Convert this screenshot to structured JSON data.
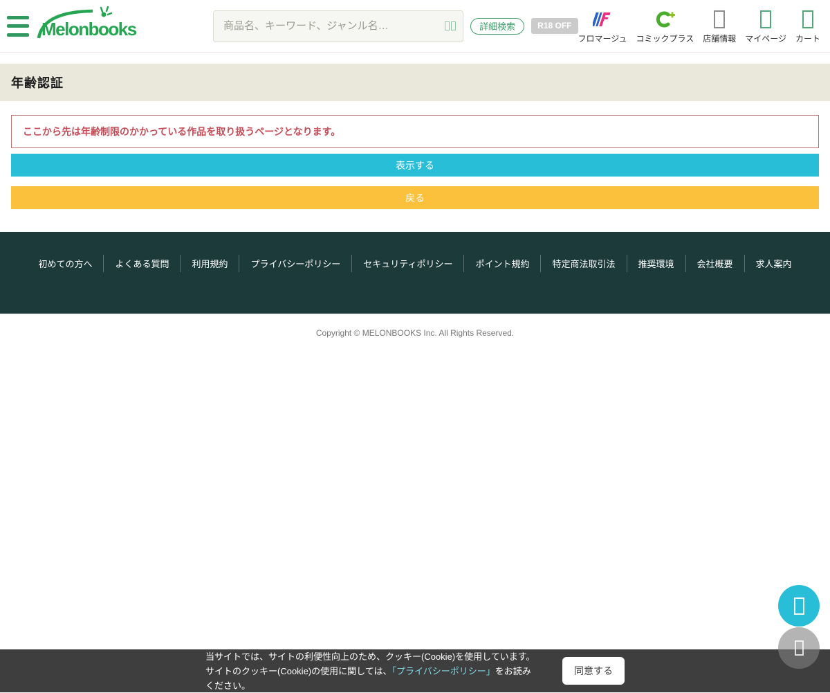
{
  "header": {
    "logo_text": "Melonbooks",
    "search": {
      "placeholder": "商品名、キーワード、ジャンル名…"
    },
    "advanced_search_label": "詳細検索",
    "r18_badge": "R18 OFF",
    "nav_items": [
      {
        "label": "フロマージュ",
        "icon": "fromage-logo-icon"
      },
      {
        "label": "コミックプラス",
        "icon": "comicplus-logo-icon"
      },
      {
        "label": "店舗情報",
        "icon": "store-info-icon"
      },
      {
        "label": "マイページ",
        "icon": "mypage-icon"
      },
      {
        "label": "カート",
        "icon": "cart-icon"
      }
    ]
  },
  "page": {
    "title": "年齢認証",
    "warning": "ここから先は年齢制限のかかっている作品を取り扱うページとなります。",
    "show_button": "表示する",
    "back_button": "戻る"
  },
  "footer": {
    "links": [
      "初めての方へ",
      "よくある質問",
      "利用規約",
      "プライバシーポリシー",
      "セキュリティポリシー",
      "ポイント規約",
      "特定商法取引法",
      "推奨環境",
      "会社概要",
      "求人案内"
    ],
    "copyright": "Copyright © MELONBOOKS Inc. All Rights Reserved."
  },
  "cookie_banner": {
    "text_before_link": "当サイトでは、サイトの利便性向上のため、クッキー(Cookie)を使用しています。サイトのクッキー(Cookie)の使用に関しては、",
    "link_text": "「プライバシーポリシー」",
    "text_after_link": "をお読みください。",
    "agree_button": "同意する"
  },
  "colors": {
    "brand_green": "#26a652",
    "accent_cyan": "#29bed8",
    "accent_yellow": "#fbc03c",
    "warning_red": "#c44d58",
    "footer_teal": "#1d3a3a",
    "title_bar_beige": "#e9e8db",
    "cookie_bar_gray": "#3e3e3e"
  }
}
